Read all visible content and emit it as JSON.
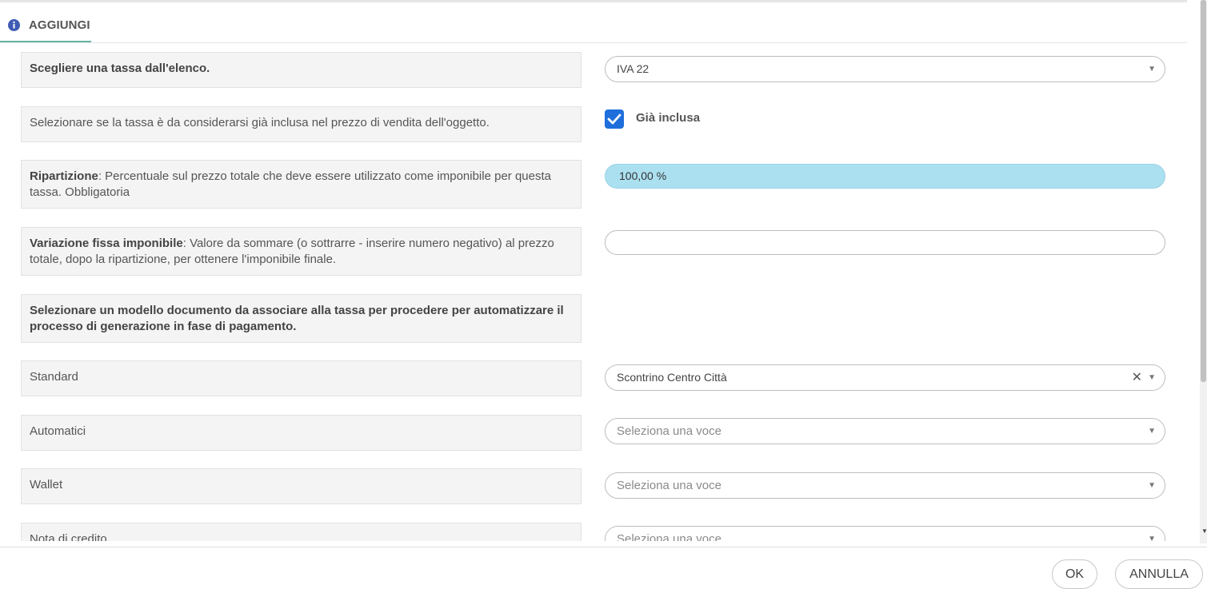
{
  "header": {
    "title": "AGGIUNGI"
  },
  "tax": {
    "label": "Scegliere una tassa dall'elenco.",
    "value": "IVA 22"
  },
  "included": {
    "description": "Selezionare se la tassa è da considerarsi già inclusa nel prezzo di vendita dell'oggetto.",
    "checkbox_label": "Già inclusa",
    "checked": true
  },
  "split": {
    "title": "Ripartizione",
    "description": ": Percentuale sul prezzo totale che deve essere utilizzato come imponibile per questa tassa. Obbligatoria",
    "value": "100,00 %"
  },
  "fixed_variation": {
    "title": "Variazione fissa imponibile",
    "description": ": Valore da sommare (o sottrarre - inserire numero negativo) al prezzo totale, dopo la ripartizione, per ottenere l'imponibile finale.",
    "value": ""
  },
  "document_model": {
    "label": "Selezionare un modello documento da associare alla tassa per procedere per automatizzare il processo di generazione in fase di pagamento."
  },
  "standard": {
    "label": "Standard",
    "value": "Scontrino Centro Città"
  },
  "automatic": {
    "label": "Automatici",
    "placeholder": "Seleziona una voce"
  },
  "wallet": {
    "label": "Wallet",
    "placeholder": "Seleziona una voce"
  },
  "credit_note": {
    "label": "Nota di credito",
    "placeholder": "Seleziona una voce"
  },
  "footer": {
    "ok_label": "OK",
    "cancel_label": "ANNULLA"
  },
  "colors": {
    "accent": "#1e6fdb",
    "bar": "#abe0f0",
    "tab_underline": "#66b4a4"
  },
  "icons": {
    "info": "info-icon",
    "caret": "chevron-down-icon",
    "clear": "close-icon",
    "check": "checkmark-icon"
  }
}
